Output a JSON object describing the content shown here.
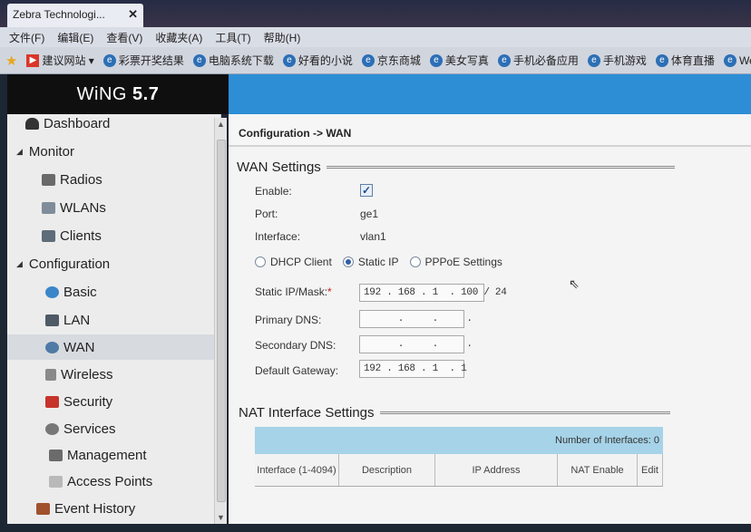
{
  "browser": {
    "tab_title": "Zebra Technologi...",
    "tab_close": "✕",
    "menu": [
      "文件(F)",
      "编辑(E)",
      "查看(V)",
      "收藏夹(A)",
      "工具(T)",
      "帮助(H)"
    ],
    "favorites": [
      "建议网站 ▾",
      "彩票开奖结果",
      "电脑系统下载",
      "好看的小说",
      "京东商城",
      "美女写真",
      "手机必备应用",
      "手机游戏",
      "体育直播",
      "We"
    ]
  },
  "app": {
    "logo": "WiNG",
    "version": "5.7"
  },
  "sidebar": {
    "items": [
      {
        "label": "Dashboard",
        "icon": "dashboard-icon",
        "level": 0
      },
      {
        "label": "Monitor",
        "icon": "collapse-triangle-icon",
        "level": 0
      },
      {
        "label": "Radios",
        "icon": "radio-icon",
        "level": 1
      },
      {
        "label": "WLANs",
        "icon": "wlan-icon",
        "level": 1
      },
      {
        "label": "Clients",
        "icon": "clients-icon",
        "level": 1
      },
      {
        "label": "Configuration",
        "icon": "collapse-triangle-icon",
        "level": 0
      },
      {
        "label": "Basic",
        "icon": "globe-icon",
        "level": 1
      },
      {
        "label": "LAN",
        "icon": "lan-icon",
        "level": 1
      },
      {
        "label": "WAN",
        "icon": "wan-icon",
        "level": 1
      },
      {
        "label": "Wireless",
        "icon": "wireless-icon",
        "level": 1
      },
      {
        "label": "Security",
        "icon": "security-icon",
        "level": 1
      },
      {
        "label": "Services",
        "icon": "services-icon",
        "level": 1
      },
      {
        "label": "Management",
        "icon": "management-icon",
        "level": 1
      },
      {
        "label": "Access Points",
        "icon": "access-point-icon",
        "level": 1
      },
      {
        "label": "Event History",
        "icon": "event-history-icon",
        "level": 0
      }
    ],
    "selected": "WAN"
  },
  "main": {
    "breadcrumb": "Configuration -> WAN",
    "wan": {
      "title": "WAN Settings",
      "enable_label": "Enable:",
      "enable_checked": "✓",
      "port_label": "Port:",
      "port_value": "ge1",
      "interface_label": "Interface:",
      "interface_value": "vlan1",
      "modes": [
        "DHCP Client",
        "Static IP",
        "PPPoE Settings"
      ],
      "selected_mode": "Static IP",
      "static_ip_label": "Static IP/Mask:",
      "required_mark": "*",
      "static_ip_value": "192 . 168 . 1  . 100 / 24",
      "primary_dns_label": "Primary DNS:",
      "primary_dns_value": "      .     .     .",
      "secondary_dns_label": "Secondary DNS:",
      "secondary_dns_value": "      .     .     .",
      "gateway_label": "Default Gateway:",
      "gateway_value": "192 . 168 . 1  . 1"
    },
    "nat": {
      "title": "NAT Interface Settings",
      "count_label": "Number of Interfaces: 0",
      "columns": [
        "Interface (1-4094)",
        "Description",
        "IP Address",
        "NAT Enable",
        "Edit"
      ]
    }
  }
}
